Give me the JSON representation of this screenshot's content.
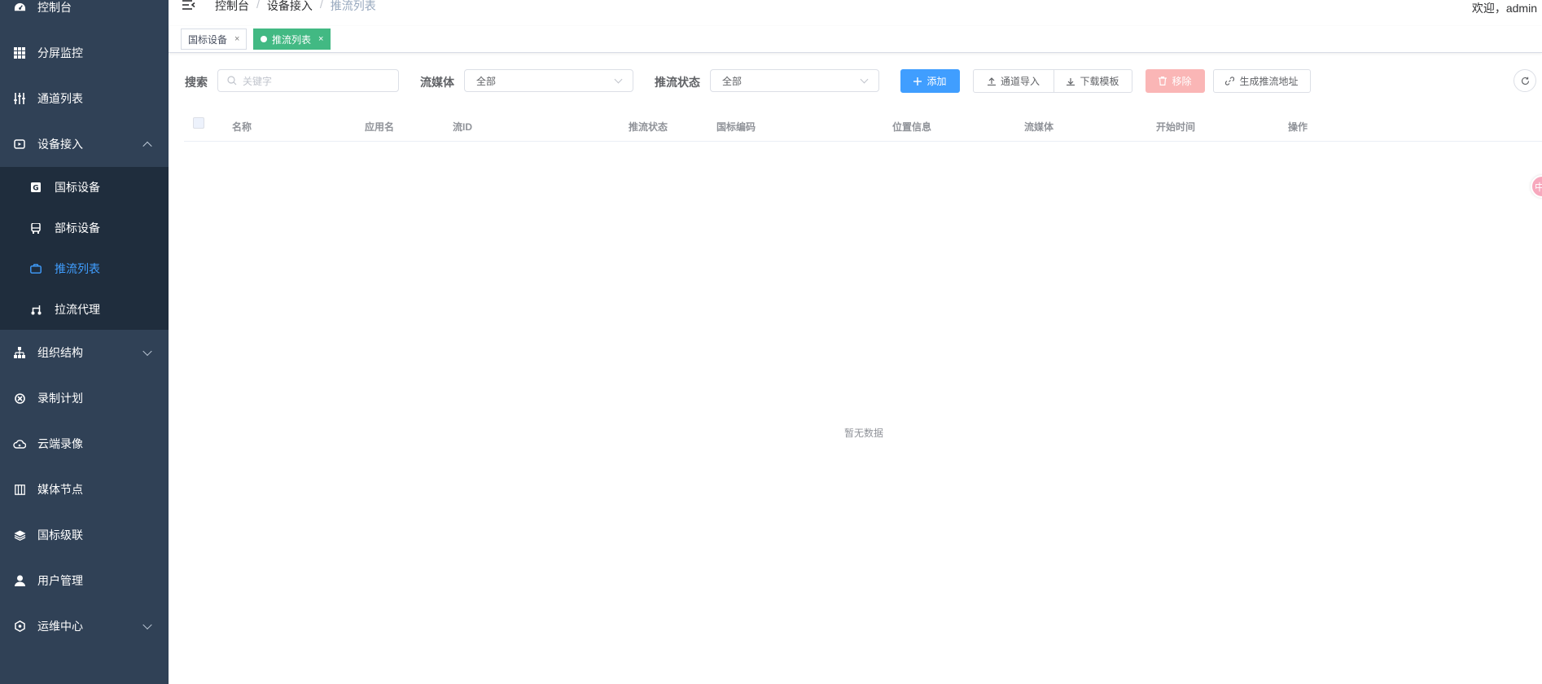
{
  "sidebar": {
    "items": [
      {
        "label": "控制台",
        "icon": "dashboard-icon"
      },
      {
        "label": "分屏监控",
        "icon": "grid-icon"
      },
      {
        "label": "通道列表",
        "icon": "sliders-icon"
      },
      {
        "label": "设备接入",
        "icon": "video-device-icon",
        "expanded": true
      },
      {
        "label": "组织结构",
        "icon": "org-tree-icon"
      },
      {
        "label": "录制计划",
        "icon": "record-plan-icon"
      },
      {
        "label": "云端录像",
        "icon": "cloud-icon"
      },
      {
        "label": "媒体节点",
        "icon": "media-node-icon"
      },
      {
        "label": "国标级联",
        "icon": "layers-icon"
      },
      {
        "label": "用户管理",
        "icon": "user-icon"
      },
      {
        "label": "运维中心",
        "icon": "hexagon-icon"
      }
    ],
    "subitems": [
      {
        "label": "国标设备",
        "icon": "gb-device-icon"
      },
      {
        "label": "部标设备",
        "icon": "bus-icon"
      },
      {
        "label": "推流列表",
        "icon": "camera-icon",
        "active": true
      },
      {
        "label": "拉流代理",
        "icon": "proxy-icon"
      }
    ],
    "background": "#304156",
    "active_color": "#409eff"
  },
  "header": {
    "breadcrumb": [
      "控制台",
      "设备接入",
      "推流列表"
    ],
    "welcome": "欢迎，admin"
  },
  "tags": [
    {
      "label": "国标设备",
      "close": "×"
    },
    {
      "label": "推流列表",
      "close": "×",
      "active": true
    }
  ],
  "filters": {
    "search_label": "搜索",
    "search_placeholder": "关键字",
    "media_label": "流媒体",
    "media_value": "全部",
    "status_label": "推流状态",
    "status_value": "全部"
  },
  "buttons": {
    "add": "添加",
    "import": "通道导入",
    "download": "下载模板",
    "remove": "移除",
    "generate": "生成推流地址"
  },
  "table": {
    "columns": [
      "名称",
      "应用名",
      "流ID",
      "推流状态",
      "国标编码",
      "位置信息",
      "流媒体",
      "开始时间",
      "操作"
    ],
    "rows": [],
    "empty_text": "暂无数据"
  },
  "float_badge": "中",
  "colors": {
    "primary": "#409eff",
    "tag_active": "#42b983",
    "danger_disabled": "#fab6b6"
  }
}
